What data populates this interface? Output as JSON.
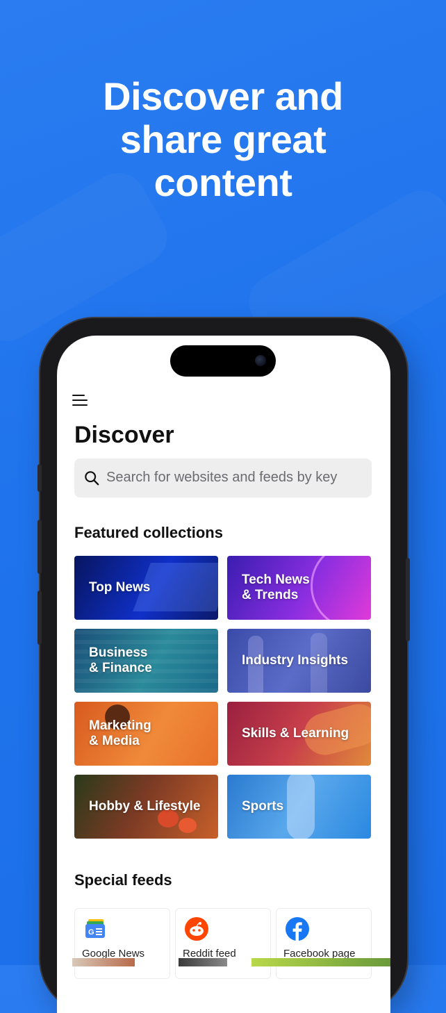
{
  "headline": {
    "line1": "Discover and",
    "line2": "share great",
    "line3": "content"
  },
  "app": {
    "page_title": "Discover",
    "search": {
      "placeholder": "Search for websites and feeds by key"
    },
    "featured": {
      "title": "Featured collections",
      "tiles": [
        {
          "label": "Top News",
          "gradient": "#0a1a8a"
        },
        {
          "label_line1": "Tech News",
          "label_line2": "& Trends",
          "gradient": "#7a2ad8"
        },
        {
          "label_line1": "Business",
          "label_line2": "& Finance",
          "gradient": "#1e6f8a"
        },
        {
          "label": "Industry Insights",
          "gradient": "#4a5bb8"
        },
        {
          "label_line1": "Marketing",
          "label_line2": "& Media",
          "gradient": "#e8762a"
        },
        {
          "label": "Skills & Learning",
          "gradient": "#b8304a"
        },
        {
          "label": "Hobby & Lifestyle",
          "gradient": "#7a3a24"
        },
        {
          "label": "Sports",
          "gradient": "#2a8ad8"
        }
      ]
    },
    "special": {
      "title": "Special feeds",
      "feeds": [
        {
          "label": "Google News",
          "icon": "google-news-icon"
        },
        {
          "label": "Reddit feed",
          "icon": "reddit-icon"
        },
        {
          "label": "Facebook page",
          "icon": "facebook-icon"
        }
      ]
    }
  },
  "colors": {
    "background": "#1f73ec",
    "reddit": "#ff4500",
    "facebook": "#1877f2"
  }
}
